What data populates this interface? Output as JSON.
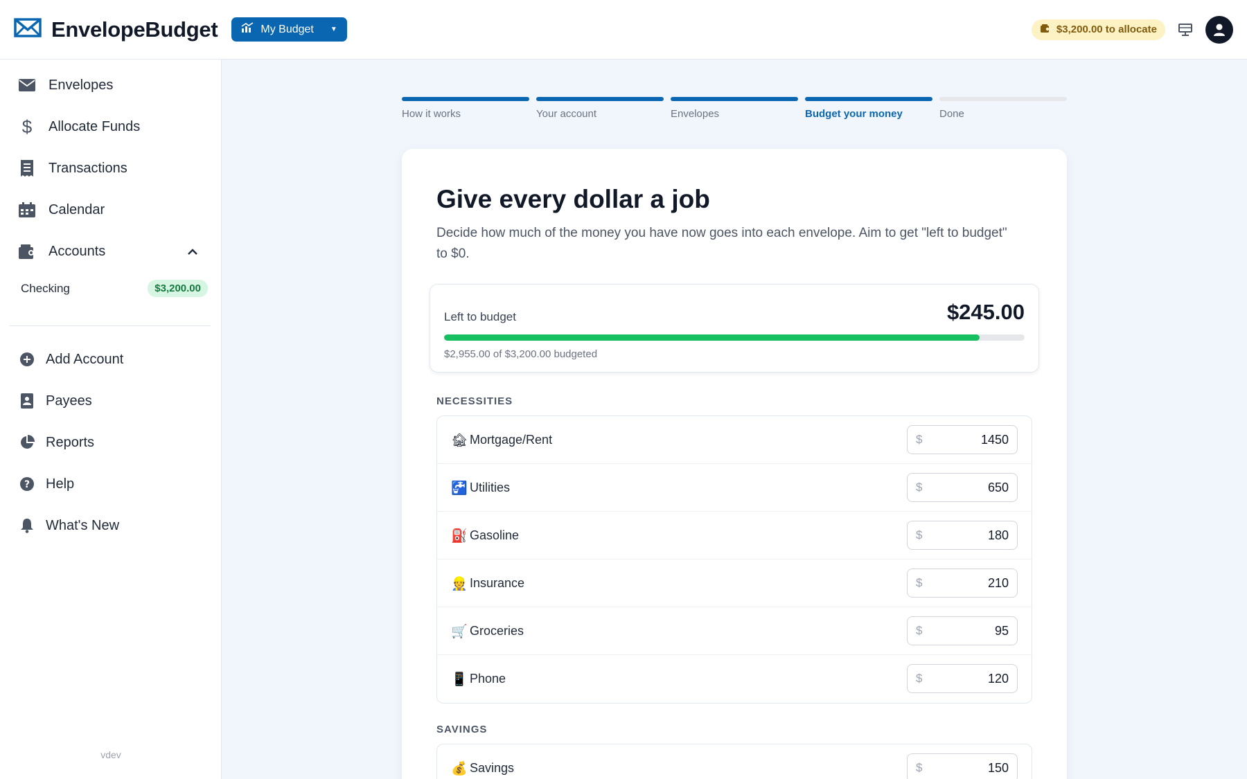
{
  "header": {
    "app_name": "EnvelopeBudget",
    "budget_selector": "My Budget",
    "allocate_badge": "$3,200.00 to allocate"
  },
  "sidebar": {
    "items": [
      {
        "label": "Envelopes",
        "icon": "envelope-icon"
      },
      {
        "label": "Allocate Funds",
        "icon": "dollar-icon"
      },
      {
        "label": "Transactions",
        "icon": "receipt-icon"
      },
      {
        "label": "Calendar",
        "icon": "calendar-icon"
      },
      {
        "label": "Accounts",
        "icon": "wallet-icon"
      }
    ],
    "accounts": [
      {
        "name": "Checking",
        "balance": "$3,200.00"
      }
    ],
    "secondary": [
      {
        "label": "Add Account",
        "icon": "plus-circle-icon"
      },
      {
        "label": "Payees",
        "icon": "contact-icon"
      },
      {
        "label": "Reports",
        "icon": "pie-chart-icon"
      },
      {
        "label": "Help",
        "icon": "question-icon"
      },
      {
        "label": "What's New",
        "icon": "bell-icon"
      }
    ],
    "version": "vdev"
  },
  "stepper": {
    "steps": [
      "How it works",
      "Your account",
      "Envelopes",
      "Budget your money",
      "Done"
    ],
    "active_index": 3
  },
  "card": {
    "title": "Give every dollar a job",
    "description": "Decide how much of the money you have now goes into each envelope. Aim to get \"left to budget\" to $0.",
    "left_to_budget": {
      "label": "Left to budget",
      "amount": "$245.00",
      "progress_fraction": 0.923,
      "summary": "$2,955.00 of $3,200.00 budgeted"
    },
    "sections": [
      {
        "label": "NECESSITIES",
        "envelopes": [
          {
            "emoji": "🏚",
            "name": "Mortgage/Rent",
            "amount": "1450"
          },
          {
            "emoji": "🚰",
            "name": "Utilities",
            "amount": "650"
          },
          {
            "emoji": "⛽",
            "name": "Gasoline",
            "amount": "180"
          },
          {
            "emoji": "👷",
            "name": "Insurance",
            "amount": "210"
          },
          {
            "emoji": "🛒",
            "name": "Groceries",
            "amount": "95"
          },
          {
            "emoji": "📱",
            "name": "Phone",
            "amount": "120"
          }
        ]
      },
      {
        "label": "SAVINGS",
        "envelopes": [
          {
            "emoji": "💰",
            "name": "Savings",
            "amount": "150"
          }
        ]
      }
    ],
    "currency_symbol": "$"
  }
}
